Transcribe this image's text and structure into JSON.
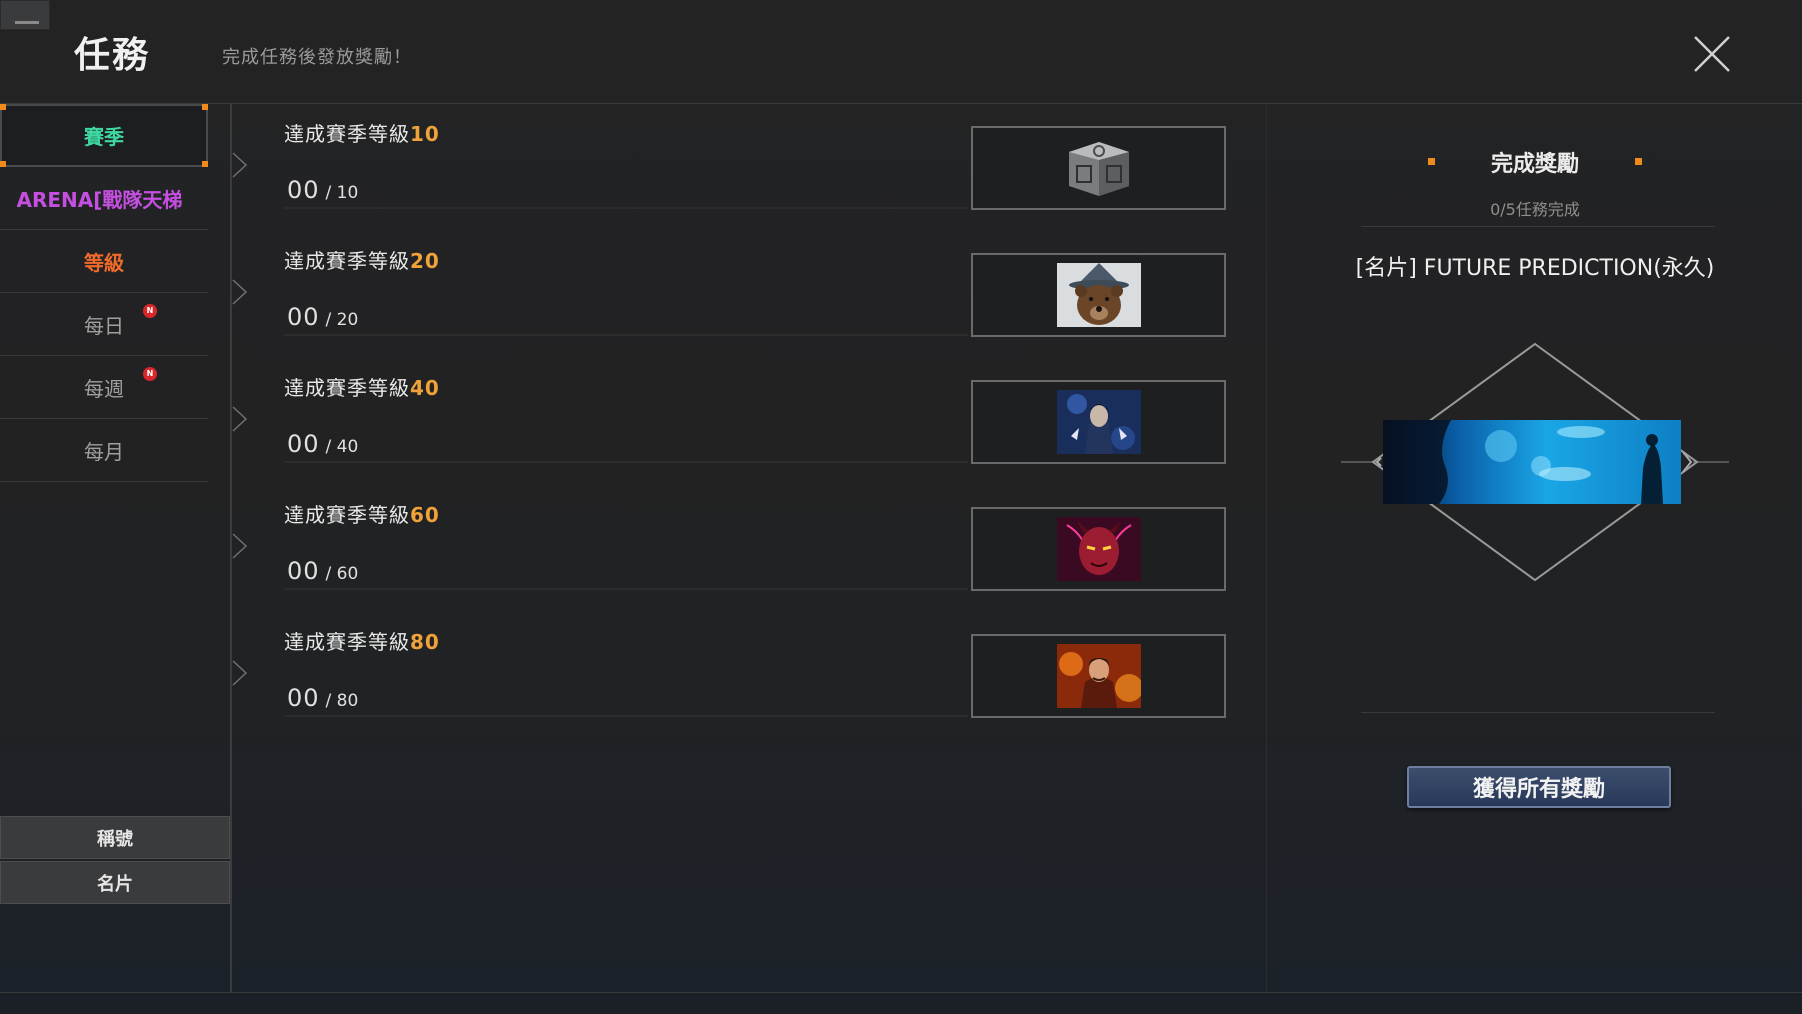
{
  "header": {
    "title": "任務",
    "subtitle": "完成任務後發放獎勵！"
  },
  "sidebar": {
    "items": [
      {
        "label": "賽季",
        "color": "#3fd7a2",
        "active": true,
        "badge": ""
      },
      {
        "label": "ARENA[戰隊天梯",
        "color": "#c44fe0",
        "active": false,
        "badge": ""
      },
      {
        "label": "等級",
        "color": "#f06a2a",
        "active": false,
        "badge": ""
      },
      {
        "label": "每日",
        "color": "#a0a0a0",
        "active": false,
        "badge": "N"
      },
      {
        "label": "每週",
        "color": "#a0a0a0",
        "active": false,
        "badge": "N"
      },
      {
        "label": "每月",
        "color": "#a0a0a0",
        "active": false,
        "badge": ""
      }
    ],
    "bottom_buttons": [
      "稱號",
      "名片"
    ]
  },
  "quests": [
    {
      "title": "達成賽季等級",
      "level": "10",
      "current": "00",
      "total": "/ 10",
      "reward_icon": "chest-icon"
    },
    {
      "title": "達成賽季等級",
      "level": "20",
      "current": "00",
      "total": "/ 20",
      "reward_icon": "bear-wizard-portrait"
    },
    {
      "title": "達成賽季等級",
      "level": "40",
      "current": "00",
      "total": "/ 40",
      "reward_icon": "blue-mage-portrait"
    },
    {
      "title": "達成賽季等級",
      "level": "60",
      "current": "00",
      "total": "/ 60",
      "reward_icon": "red-demon-portrait"
    },
    {
      "title": "達成賽季等級",
      "level": "80",
      "current": "00",
      "total": "/ 80",
      "reward_icon": "fire-sorcerer-portrait"
    }
  ],
  "panel": {
    "heading": "完成獎勵",
    "progress": "0/5任務完成",
    "reward_name": "[名片] FUTURE PREDICTION(永久)",
    "claim_button": "獲得所有獎勵"
  },
  "colors": {
    "accent_orange": "#f08a1c",
    "level_number": "#f0a23a"
  }
}
